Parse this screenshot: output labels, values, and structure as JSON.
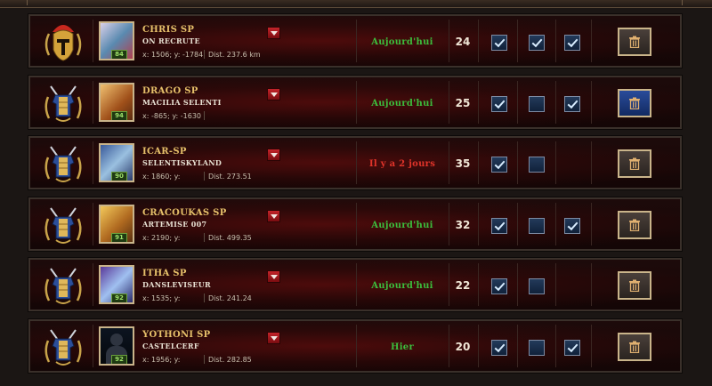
{
  "players": [
    {
      "rank_icon": "spartan-helmet-icon",
      "avatar_icon": "hero-portrait",
      "level": "84",
      "name": "Chris SP",
      "city": "On Recrute",
      "coords": "x: 1506; y: -1784",
      "distance": "Dist. 237.6 km",
      "status": "Aujourd'hui",
      "status_color": "#3cbc3c",
      "count": "24",
      "checks": [
        true,
        true,
        true
      ],
      "delete_active": false
    },
    {
      "rank_icon": "armor-medal-icon",
      "avatar_icon": "hero-portrait",
      "level": "94",
      "name": "Drago SP",
      "city": "MACILIA selenti",
      "coords": "x: -865; y: -1630",
      "distance": "",
      "status": "Aujourd'hui",
      "status_color": "#3cbc3c",
      "count": "25",
      "checks": [
        true,
        false,
        true
      ],
      "delete_active": true
    },
    {
      "rank_icon": "armor-medal-icon",
      "avatar_icon": "hero-portrait",
      "level": "90",
      "name": "icar-SP",
      "city": "selentiSkyland",
      "coords": "x: 1860; y:",
      "distance": "Dist. 273.51",
      "status": "Il y a 2 jours",
      "status_color": "#e0342a",
      "count": "35",
      "checks": [
        true,
        false,
        null
      ],
      "delete_active": false
    },
    {
      "rank_icon": "armor-medal-icon",
      "avatar_icon": "hero-portrait",
      "level": "91",
      "name": "cracoukas SP",
      "city": "artemise 007",
      "coords": "x: 2190; y:",
      "distance": "Dist. 499.35",
      "status": "Aujourd'hui",
      "status_color": "#3cbc3c",
      "count": "32",
      "checks": [
        true,
        false,
        true
      ],
      "delete_active": false
    },
    {
      "rank_icon": "armor-medal-icon",
      "avatar_icon": "hero-portrait",
      "level": "92",
      "name": "itha SP",
      "city": "dansleviseur",
      "coords": "x: 1535; y:",
      "distance": "Dist. 241.24",
      "status": "Aujourd'hui",
      "status_color": "#3cbc3c",
      "count": "22",
      "checks": [
        true,
        false,
        null
      ],
      "delete_active": false
    },
    {
      "rank_icon": "armor-medal-icon",
      "avatar_icon": "silhouette-portrait",
      "level": "92",
      "name": "YOTHONI SP",
      "city": "CASTELCERF",
      "coords": "x: 1956; y:",
      "distance": "Dist. 282.85",
      "status": "Hier",
      "status_color": "#3cbc3c",
      "count": "20",
      "checks": [
        true,
        false,
        true
      ],
      "delete_active": false
    }
  ],
  "colors": {
    "name": "#e6c06a",
    "checkbox": "#1a2f4e",
    "delete_active": "#1e3f86"
  }
}
